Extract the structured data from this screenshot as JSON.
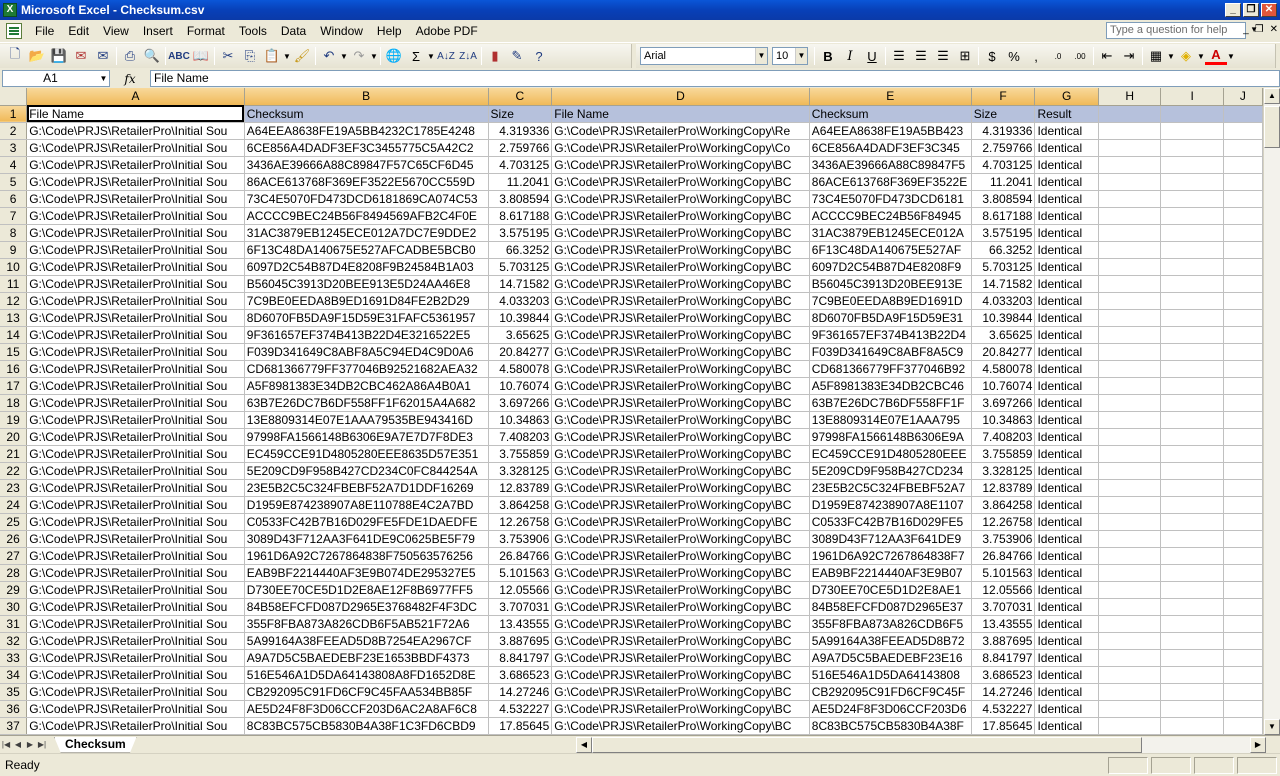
{
  "window": {
    "title": "Microsoft Excel - Checksum.csv"
  },
  "menu": [
    "File",
    "Edit",
    "View",
    "Insert",
    "Format",
    "Tools",
    "Data",
    "Window",
    "Help",
    "Adobe PDF"
  ],
  "help_placeholder": "Type a question for help",
  "toolbar": {
    "font": "Arial",
    "size": "10"
  },
  "formula": {
    "cell": "A1",
    "content": "File Name"
  },
  "columns": [
    "A",
    "B",
    "C",
    "D",
    "E",
    "F",
    "G",
    "H",
    "I",
    "J"
  ],
  "header_row": [
    "File Name",
    "Checksum",
    "Size",
    "File Name",
    "Checksum",
    "Size",
    "Result"
  ],
  "rows": [
    [
      "G:\\Code\\PRJS\\RetailerPro\\Initial Sou",
      "A64EEA8638FE19A5BB4232C1785E4248",
      "4.319336",
      "G:\\Code\\PRJS\\RetailerPro\\WorkingCopy\\Re",
      "A64EEA8638FE19A5BB423",
      "4.319336",
      "Identical"
    ],
    [
      "G:\\Code\\PRJS\\RetailerPro\\Initial Sou",
      "6CE856A4DADF3EF3C3455775C5A42C2",
      "2.759766",
      "G:\\Code\\PRJS\\RetailerPro\\WorkingCopy\\Co",
      "6CE856A4DADF3EF3C345",
      "2.759766",
      "Identical"
    ],
    [
      "G:\\Code\\PRJS\\RetailerPro\\Initial Sou",
      "3436AE39666A88C89847F57C65CF6D45",
      "4.703125",
      "G:\\Code\\PRJS\\RetailerPro\\WorkingCopy\\BC",
      "3436AE39666A88C89847F5",
      "4.703125",
      "Identical"
    ],
    [
      "G:\\Code\\PRJS\\RetailerPro\\Initial Sou",
      "86ACE613768F369EF3522E5670CC559D",
      "11.2041",
      "G:\\Code\\PRJS\\RetailerPro\\WorkingCopy\\BC",
      "86ACE613768F369EF3522E",
      "11.2041",
      "Identical"
    ],
    [
      "G:\\Code\\PRJS\\RetailerPro\\Initial Sou",
      "73C4E5070FD473DCD6181869CA074C53",
      "3.808594",
      "G:\\Code\\PRJS\\RetailerPro\\WorkingCopy\\BC",
      "73C4E5070FD473DCD6181",
      "3.808594",
      "Identical"
    ],
    [
      "G:\\Code\\PRJS\\RetailerPro\\Initial Sou",
      "ACCCC9BEC24B56F8494569AFB2C4F0E",
      "8.617188",
      "G:\\Code\\PRJS\\RetailerPro\\WorkingCopy\\BC",
      "ACCCC9BEC24B56F84945",
      "8.617188",
      "Identical"
    ],
    [
      "G:\\Code\\PRJS\\RetailerPro\\Initial Sou",
      "31AC3879EB1245ECE012A7DC7E9DDE2",
      "3.575195",
      "G:\\Code\\PRJS\\RetailerPro\\WorkingCopy\\BC",
      "31AC3879EB1245ECE012A",
      "3.575195",
      "Identical"
    ],
    [
      "G:\\Code\\PRJS\\RetailerPro\\Initial Sou",
      "6F13C48DA140675E527AFCADBE5BCB0",
      "66.3252",
      "G:\\Code\\PRJS\\RetailerPro\\WorkingCopy\\BC",
      "6F13C48DA140675E527AF",
      "66.3252",
      "Identical"
    ],
    [
      "G:\\Code\\PRJS\\RetailerPro\\Initial Sou",
      "6097D2C54B87D4E8208F9B24584B1A03",
      "5.703125",
      "G:\\Code\\PRJS\\RetailerPro\\WorkingCopy\\BC",
      "6097D2C54B87D4E8208F9",
      "5.703125",
      "Identical"
    ],
    [
      "G:\\Code\\PRJS\\RetailerPro\\Initial Sou",
      "B56045C3913D20BEE913E5D24AA46E8",
      "14.71582",
      "G:\\Code\\PRJS\\RetailerPro\\WorkingCopy\\BC",
      "B56045C3913D20BEE913E",
      "14.71582",
      "Identical"
    ],
    [
      "G:\\Code\\PRJS\\RetailerPro\\Initial Sou",
      "7C9BE0EEDA8B9ED1691D84FE2B2D29",
      "4.033203",
      "G:\\Code\\PRJS\\RetailerPro\\WorkingCopy\\BC",
      "7C9BE0EEDA8B9ED1691D",
      "4.033203",
      "Identical"
    ],
    [
      "G:\\Code\\PRJS\\RetailerPro\\Initial Sou",
      "8D6070FB5DA9F15D59E31FAFC5361957",
      "10.39844",
      "G:\\Code\\PRJS\\RetailerPro\\WorkingCopy\\BC",
      "8D6070FB5DA9F15D59E31",
      "10.39844",
      "Identical"
    ],
    [
      "G:\\Code\\PRJS\\RetailerPro\\Initial Sou",
      "9F361657EF374B413B22D4E3216522E5",
      "3.65625",
      "G:\\Code\\PRJS\\RetailerPro\\WorkingCopy\\BC",
      "9F361657EF374B413B22D4",
      "3.65625",
      "Identical"
    ],
    [
      "G:\\Code\\PRJS\\RetailerPro\\Initial Sou",
      "F039D341649C8ABF8A5C94ED4C9D0A6",
      "20.84277",
      "G:\\Code\\PRJS\\RetailerPro\\WorkingCopy\\BC",
      "F039D341649C8ABF8A5C9",
      "20.84277",
      "Identical"
    ],
    [
      "G:\\Code\\PRJS\\RetailerPro\\Initial Sou",
      "CD681366779FF377046B92521682AEA32",
      "4.580078",
      "G:\\Code\\PRJS\\RetailerPro\\WorkingCopy\\BC",
      "CD681366779FF377046B92",
      "4.580078",
      "Identical"
    ],
    [
      "G:\\Code\\PRJS\\RetailerPro\\Initial Sou",
      "A5F8981383E34DB2CBC462A86A4B0A1",
      "10.76074",
      "G:\\Code\\PRJS\\RetailerPro\\WorkingCopy\\BC",
      "A5F8981383E34DB2CBC46",
      "10.76074",
      "Identical"
    ],
    [
      "G:\\Code\\PRJS\\RetailerPro\\Initial Sou",
      "63B7E26DC7B6DF558FF1F62015A4A682",
      "3.697266",
      "G:\\Code\\PRJS\\RetailerPro\\WorkingCopy\\BC",
      "63B7E26DC7B6DF558FF1F",
      "3.697266",
      "Identical"
    ],
    [
      "G:\\Code\\PRJS\\RetailerPro\\Initial Sou",
      "13E8809314E07E1AAA79535BE943416D",
      "10.34863",
      "G:\\Code\\PRJS\\RetailerPro\\WorkingCopy\\BC",
      "13E8809314E07E1AAA795",
      "10.34863",
      "Identical"
    ],
    [
      "G:\\Code\\PRJS\\RetailerPro\\Initial Sou",
      "97998FA1566148B6306E9A7E7D7F8DE3",
      "7.408203",
      "G:\\Code\\PRJS\\RetailerPro\\WorkingCopy\\BC",
      "97998FA1566148B6306E9A",
      "7.408203",
      "Identical"
    ],
    [
      "G:\\Code\\PRJS\\RetailerPro\\Initial Sou",
      "EC459CCE91D4805280EEE8635D57E351",
      "3.755859",
      "G:\\Code\\PRJS\\RetailerPro\\WorkingCopy\\BC",
      "EC459CCE91D4805280EEE",
      "3.755859",
      "Identical"
    ],
    [
      "G:\\Code\\PRJS\\RetailerPro\\Initial Sou",
      "5E209CD9F958B427CD234C0FC844254A",
      "3.328125",
      "G:\\Code\\PRJS\\RetailerPro\\WorkingCopy\\BC",
      "5E209CD9F958B427CD234",
      "3.328125",
      "Identical"
    ],
    [
      "G:\\Code\\PRJS\\RetailerPro\\Initial Sou",
      "23E5B2C5C324FBEBF52A7D1DDF16269",
      "12.83789",
      "G:\\Code\\PRJS\\RetailerPro\\WorkingCopy\\BC",
      "23E5B2C5C324FBEBF52A7",
      "12.83789",
      "Identical"
    ],
    [
      "G:\\Code\\PRJS\\RetailerPro\\Initial Sou",
      "D1959E874238907A8E110788E4C2A7BD",
      "3.864258",
      "G:\\Code\\PRJS\\RetailerPro\\WorkingCopy\\BC",
      "D1959E874238907A8E1107",
      "3.864258",
      "Identical"
    ],
    [
      "G:\\Code\\PRJS\\RetailerPro\\Initial Sou",
      "C0533FC42B7B16D029FE5FDE1DAEDFE",
      "12.26758",
      "G:\\Code\\PRJS\\RetailerPro\\WorkingCopy\\BC",
      "C0533FC42B7B16D029FE5",
      "12.26758",
      "Identical"
    ],
    [
      "G:\\Code\\PRJS\\RetailerPro\\Initial Sou",
      "3089D43F712AA3F641DE9C0625BE5F79",
      "3.753906",
      "G:\\Code\\PRJS\\RetailerPro\\WorkingCopy\\BC",
      "3089D43F712AA3F641DE9",
      "3.753906",
      "Identical"
    ],
    [
      "G:\\Code\\PRJS\\RetailerPro\\Initial Sou",
      "1961D6A92C7267864838F750563576256",
      "26.84766",
      "G:\\Code\\PRJS\\RetailerPro\\WorkingCopy\\BC",
      "1961D6A92C7267864838F7",
      "26.84766",
      "Identical"
    ],
    [
      "G:\\Code\\PRJS\\RetailerPro\\Initial Sou",
      "EAB9BF2214440AF3E9B074DE295327E5",
      "5.101563",
      "G:\\Code\\PRJS\\RetailerPro\\WorkingCopy\\BC",
      "EAB9BF2214440AF3E9B07",
      "5.101563",
      "Identical"
    ],
    [
      "G:\\Code\\PRJS\\RetailerPro\\Initial Sou",
      "D730EE70CE5D1D2E8AE12F8B6977FF5",
      "12.05566",
      "G:\\Code\\PRJS\\RetailerPro\\WorkingCopy\\BC",
      "D730EE70CE5D1D2E8AE1",
      "12.05566",
      "Identical"
    ],
    [
      "G:\\Code\\PRJS\\RetailerPro\\Initial Sou",
      "84B58EFCFD087D2965E3768482F4F3DC",
      "3.707031",
      "G:\\Code\\PRJS\\RetailerPro\\WorkingCopy\\BC",
      "84B58EFCFD087D2965E37",
      "3.707031",
      "Identical"
    ],
    [
      "G:\\Code\\PRJS\\RetailerPro\\Initial Sou",
      "355F8FBA873A826CDB6F5AB521F72A6",
      "13.43555",
      "G:\\Code\\PRJS\\RetailerPro\\WorkingCopy\\BC",
      "355F8FBA873A826CDB6F5",
      "13.43555",
      "Identical"
    ],
    [
      "G:\\Code\\PRJS\\RetailerPro\\Initial Sou",
      "5A99164A38FEEAD5D8B7254EA2967CF",
      "3.887695",
      "G:\\Code\\PRJS\\RetailerPro\\WorkingCopy\\BC",
      "5A99164A38FEEAD5D8B72",
      "3.887695",
      "Identical"
    ],
    [
      "G:\\Code\\PRJS\\RetailerPro\\Initial Sou",
      "A9A7D5C5BAEDEBF23E1653BBDF4373",
      "8.841797",
      "G:\\Code\\PRJS\\RetailerPro\\WorkingCopy\\BC",
      "A9A7D5C5BAEDEBF23E16",
      "8.841797",
      "Identical"
    ],
    [
      "G:\\Code\\PRJS\\RetailerPro\\Initial Sou",
      "516E546A1D5DA64143808A8FD1652D8E",
      "3.686523",
      "G:\\Code\\PRJS\\RetailerPro\\WorkingCopy\\BC",
      "516E546A1D5DA64143808",
      "3.686523",
      "Identical"
    ],
    [
      "G:\\Code\\PRJS\\RetailerPro\\Initial Sou",
      "CB292095C91FD6CF9C45FAA534BB85F",
      "14.27246",
      "G:\\Code\\PRJS\\RetailerPro\\WorkingCopy\\BC",
      "CB292095C91FD6CF9C45F",
      "14.27246",
      "Identical"
    ],
    [
      "G:\\Code\\PRJS\\RetailerPro\\Initial Sou",
      "AE5D24F8F3D06CCF203D6AC2A8AF6C8",
      "4.532227",
      "G:\\Code\\PRJS\\RetailerPro\\WorkingCopy\\BC",
      "AE5D24F8F3D06CCF203D6",
      "4.532227",
      "Identical"
    ],
    [
      "G:\\Code\\PRJS\\RetailerPro\\Initial Sou",
      "8C83BC575CB5830B4A38F1C3FD6CBD9",
      "17.85645",
      "G:\\Code\\PRJS\\RetailerPro\\WorkingCopy\\BC",
      "8C83BC575CB5830B4A38F",
      "17.85645",
      "Identical"
    ]
  ],
  "sheet_tab": "Checksum",
  "status": "Ready"
}
